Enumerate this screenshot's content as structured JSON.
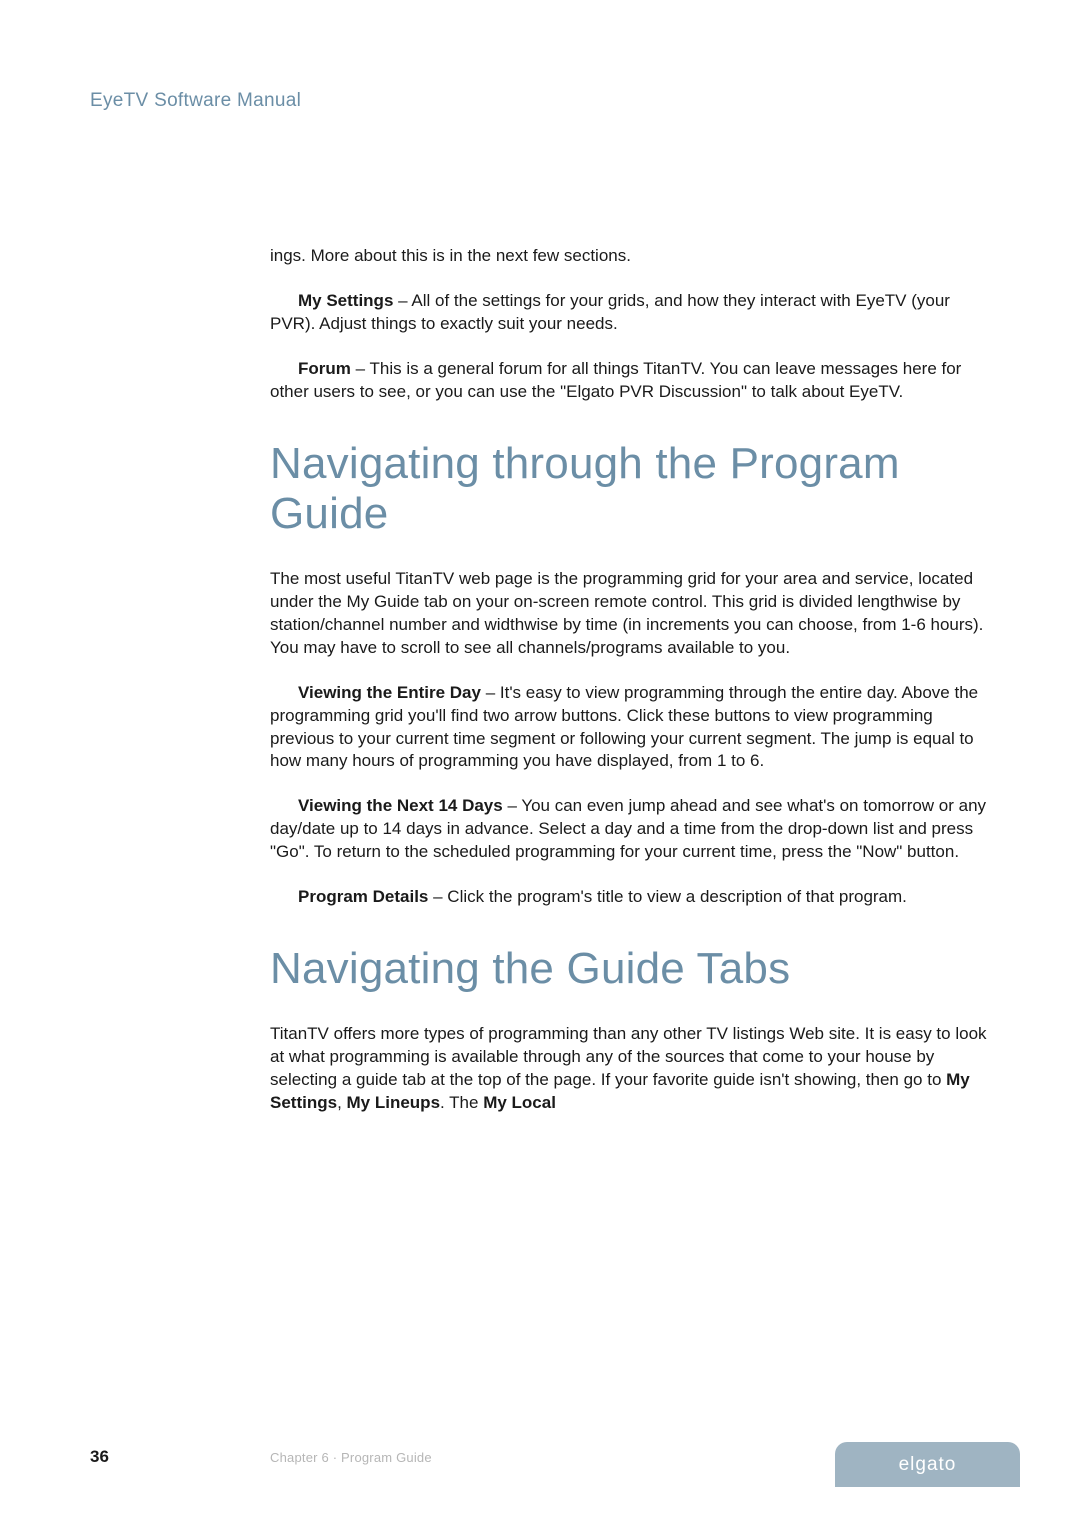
{
  "header": {
    "product_name": "EyeTV Software Manual"
  },
  "body": {
    "p1": "ings.  More about this is in the next few sections.",
    "p2_bold": "My Settings",
    "p2_rest": " – All of the settings for your grids, and how they interact with EyeTV (your PVR).  Adjust things to exactly suit your needs.",
    "p3_bold": "Forum",
    "p3_rest": " – This is a general forum for all things TitanTV.  You can leave messages here for other users to see, or you can use the \"Elgato PVR Discussion\" to talk about EyeTV.",
    "h1a": "Navigating through the Program Guide",
    "p4": "The most useful TitanTV web page is the programming grid for your area and service, located under the My Guide tab on your on-screen remote control. This grid is divided lengthwise by station/channel number and widthwise by time (in increments you can choose, from 1-6 hours). You may have to scroll to see all channels/programs available to you.",
    "p5_bold": "Viewing the Entire Day",
    "p5_rest": " – It's easy to view programming through the entire day. Above the programming grid you'll find two arrow buttons. Click these buttons to view programming previous to your current time segment or following your current segment. The jump is equal to how many hours of programming you have displayed, from 1 to 6.",
    "p6_bold": "Viewing the Next 14 Days",
    "p6_rest": " – You can even jump ahead and see what's on tomorrow or any day/date up to 14 days in advance. Select a day and a time from the drop-down list and press \"Go\". To return to the scheduled programming for your current time, press the \"Now\" button.",
    "p7_bold": "Program Details",
    "p7_rest": " – Click the program's title to view a description of that program.",
    "h1b": "Navigating the Guide Tabs",
    "p8_a": "TitanTV offers more types of programming than any other TV listings Web site. It is easy to look at what programming is available through any of the sources that come to your house by selecting a guide tab at the top of the page.  If your favorite guide isn't showing, then go to ",
    "p8_bold1": "My Settings",
    "p8_b": ", ",
    "p8_bold2": "My Lineups",
    "p8_c": ".  The ",
    "p8_bold3": "My Local"
  },
  "footer": {
    "page": "36",
    "chapter": "Chapter 6 · Program Guide",
    "brand": "elgato"
  }
}
